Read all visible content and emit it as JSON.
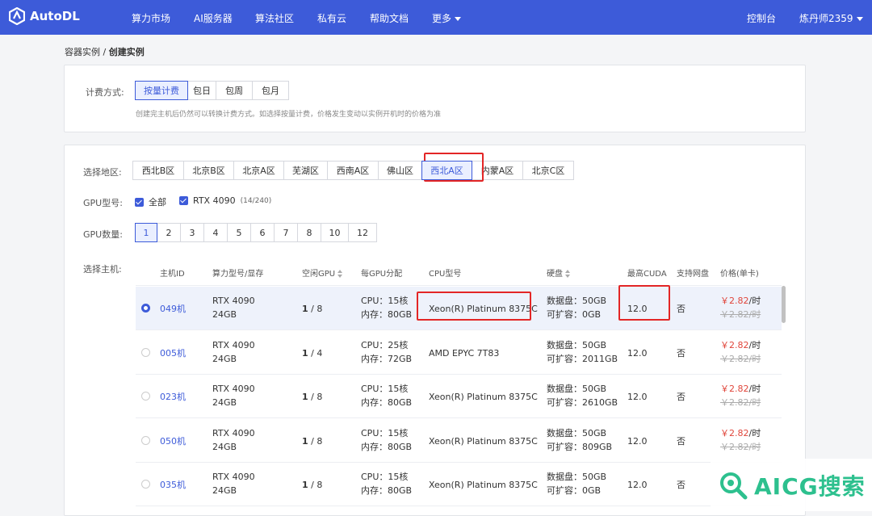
{
  "brand": {
    "name": "AutoDL"
  },
  "nav": {
    "items": [
      "算力市场",
      "AI服务器",
      "算法社区",
      "私有云",
      "帮助文档",
      "更多"
    ],
    "console": "控制台",
    "user": "炼丹师2359"
  },
  "breadcrumb": {
    "parent": "容器实例",
    "sep": "/",
    "current": "创建实例"
  },
  "billing": {
    "label": "计费方式:",
    "options": [
      "按量计费",
      "包日",
      "包周",
      "包月"
    ],
    "selected": "按量计费",
    "hint": "创建完主机后仍然可以转换计费方式。如选择按量计费，价格发生变动以实例开机时的价格为准"
  },
  "region": {
    "label": "选择地区:",
    "options": [
      "西北B区",
      "北京B区",
      "北京A区",
      "芜湖区",
      "西南A区",
      "佛山区",
      "西北A区",
      "内蒙A区",
      "北京C区"
    ],
    "selected": "西北A区"
  },
  "gpu_model": {
    "label": "GPU型号:",
    "all": "全部",
    "model": "RTX 4090",
    "availability": "(14/240)"
  },
  "gpu_count": {
    "label": "GPU数量:",
    "options": [
      "1",
      "2",
      "3",
      "4",
      "5",
      "6",
      "7",
      "8",
      "10",
      "12"
    ],
    "selected": "1"
  },
  "hosts": {
    "label": "选择主机:",
    "columns": [
      "主机ID",
      "算力型号/显存",
      "空闲GPU",
      "每GPU分配",
      "CPU型号",
      "硬盘",
      "最高CUDA",
      "支持网盘",
      "价格(单卡)"
    ],
    "rows": [
      {
        "id": "049机",
        "gpu": "RTX 4090",
        "vram": "24GB",
        "free": "1",
        "total": "/ 8",
        "cpu": "CPU：15核",
        "mem": "内存：80GB",
        "cpu_model": "Xeon(R) Platinum 8375C",
        "disk": "数据盘：50GB",
        "expand": "可扩容：0GB",
        "cuda": "12.0",
        "netdisk": "否",
        "price": "￥2.82",
        "unit": "/时",
        "old_price": "￥2.82",
        "old_unit": "/时",
        "selected": true
      },
      {
        "id": "005机",
        "gpu": "RTX 4090",
        "vram": "24GB",
        "free": "1",
        "total": "/ 4",
        "cpu": "CPU：25核",
        "mem": "内存：72GB",
        "cpu_model": "AMD EPYC 7T83",
        "disk": "数据盘：50GB",
        "expand": "可扩容：2011GB",
        "cuda": "12.0",
        "netdisk": "否",
        "price": "￥2.82",
        "unit": "/时",
        "old_price": "￥2.82",
        "old_unit": "/时",
        "selected": false
      },
      {
        "id": "023机",
        "gpu": "RTX 4090",
        "vram": "24GB",
        "free": "1",
        "total": "/ 8",
        "cpu": "CPU：15核",
        "mem": "内存：80GB",
        "cpu_model": "Xeon(R) Platinum 8375C",
        "disk": "数据盘：50GB",
        "expand": "可扩容：2610GB",
        "cuda": "12.0",
        "netdisk": "否",
        "price": "￥2.82",
        "unit": "/时",
        "old_price": "￥2.82",
        "old_unit": "/时",
        "selected": false
      },
      {
        "id": "050机",
        "gpu": "RTX 4090",
        "vram": "24GB",
        "free": "1",
        "total": "/ 8",
        "cpu": "CPU：15核",
        "mem": "内存：80GB",
        "cpu_model": "Xeon(R) Platinum 8375C",
        "disk": "数据盘：50GB",
        "expand": "可扩容：809GB",
        "cuda": "12.0",
        "netdisk": "否",
        "price": "￥2.82",
        "unit": "/时",
        "old_price": "￥2.82",
        "old_unit": "/时",
        "selected": false
      },
      {
        "id": "035机",
        "gpu": "RTX 4090",
        "vram": "24GB",
        "free": "1",
        "total": "/ 8",
        "cpu": "CPU：15核",
        "mem": "内存：80GB",
        "cpu_model": "Xeon(R) Platinum 8375C",
        "disk": "数据盘：50GB",
        "expand": "可扩容：0GB",
        "cuda": "12.0",
        "netdisk": "否",
        "price": "",
        "unit": "",
        "old_price": "",
        "old_unit": "",
        "selected": false
      }
    ]
  },
  "watermark": {
    "text": "AICG搜索"
  },
  "colors": {
    "primary": "#3d5bd9",
    "price": "#e0463b",
    "highlight": "#e32626",
    "watermark": "#2dc08e"
  }
}
